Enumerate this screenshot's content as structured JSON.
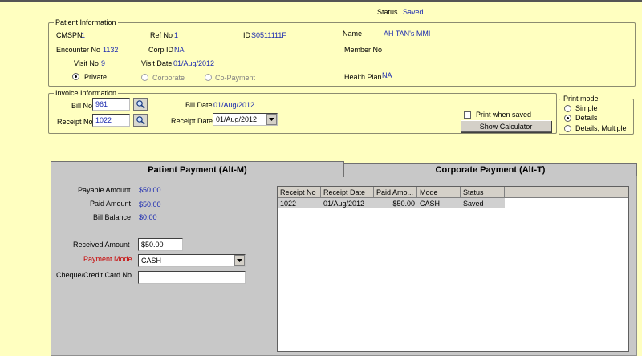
{
  "status": {
    "label": "Status",
    "value": "Saved"
  },
  "patient_info": {
    "legend": "Patient Information",
    "cmspn_label": "CMSPN",
    "cmspn_value": "1",
    "ref_no_label": "Ref No",
    "ref_no_value": "1",
    "id_label": "ID",
    "id_value": "S0511111F",
    "name_label": "Name",
    "name_value": "AH TAN's MMI",
    "encounter_label": "Encounter No",
    "encounter_value": "1132",
    "corp_id_label": "Corp ID",
    "corp_id_value": "NA",
    "member_no_label": "Member No",
    "visit_no_label": "Visit No",
    "visit_no_value": "9",
    "visit_date_label": "Visit Date",
    "visit_date_value": "01/Aug/2012",
    "radio_private": "Private",
    "radio_corporate": "Corporate",
    "radio_copayment": "Co-Payment",
    "health_plan_label": "Health Plan",
    "health_plan_value": "NA"
  },
  "invoice_info": {
    "legend": "Invoice Information",
    "bill_no_label": "Bill No",
    "bill_no_value": "961",
    "receipt_no_label": "Receipt No",
    "receipt_no_value": "1022",
    "bill_date_label": "Bill Date",
    "bill_date_value": "01/Aug/2012",
    "receipt_date_label": "Receipt Date",
    "receipt_date_value": "01/Aug/2012",
    "print_when_saved": "Print when saved",
    "show_calculator": "Show Calculator"
  },
  "print_mode": {
    "legend": "Print mode",
    "simple": "Simple",
    "details": "Details",
    "details_multiple": "Details, Multiple"
  },
  "tabs": {
    "patient_payment": "Patient Payment (Alt-M)",
    "corporate_payment": "Corporate Payment (Alt-T)"
  },
  "payment": {
    "payable_label": "Payable Amount",
    "payable_value": "$50.00",
    "paid_label": "Paid Amount",
    "paid_value": "$50.00",
    "balance_label": "Bill Balance",
    "balance_value": "$0.00",
    "received_label": "Received Amount",
    "received_value": "$50.00",
    "mode_label": "Payment Mode",
    "mode_value": "CASH",
    "cheque_label": "Cheque/Credit Card No",
    "cheque_value": ""
  },
  "receipts_table": {
    "headers": [
      "Receipt No",
      "Receipt Date",
      "Paid Amo...",
      "Mode",
      "Status"
    ],
    "rows": [
      [
        "1022",
        "01/Aug/2012",
        "$50.00",
        "CASH",
        "Saved"
      ]
    ]
  },
  "colors": {
    "background": "#ffffc0",
    "value_text": "#1c2bb0",
    "panel": "#c8c8c8",
    "required_label": "#c80000"
  },
  "icons": {
    "search": "search-icon",
    "dropdown": "chevron-down-icon"
  }
}
